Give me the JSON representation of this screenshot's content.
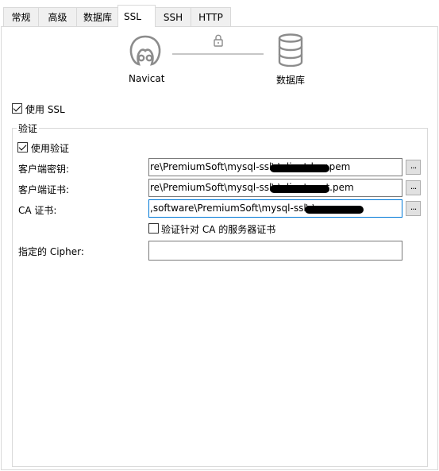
{
  "tabs": [
    "常规",
    "高级",
    "数据库",
    "SSL",
    "SSH",
    "HTTP"
  ],
  "header": {
    "left_label": "Navicat",
    "right_label": "数据库"
  },
  "use_ssl": {
    "label": "使用 SSL",
    "checked": true
  },
  "auth_group": {
    "title": "验证",
    "use_auth": {
      "label": "使用验证",
      "checked": true
    },
    "client_key": {
      "label": "客户端密钥:",
      "value": "re\\PremiumSoft\\mysql-ssl\\              \\client-key.pem"
    },
    "client_cert": {
      "label": "客户端证书:",
      "value": "re\\PremiumSoft\\mysql-ssl\\              \\client-cert.pem"
    },
    "ca_cert": {
      "label": "CA 证书:",
      "value": ",software\\PremiumSoft\\mysql-ssl\\              \\ca.pem"
    },
    "verify_ca": {
      "label": "验证针对 CA 的服务器证书",
      "checked": false
    },
    "cipher": {
      "label": "指定的 Cipher:",
      "value": ""
    },
    "browse_label": "..."
  }
}
